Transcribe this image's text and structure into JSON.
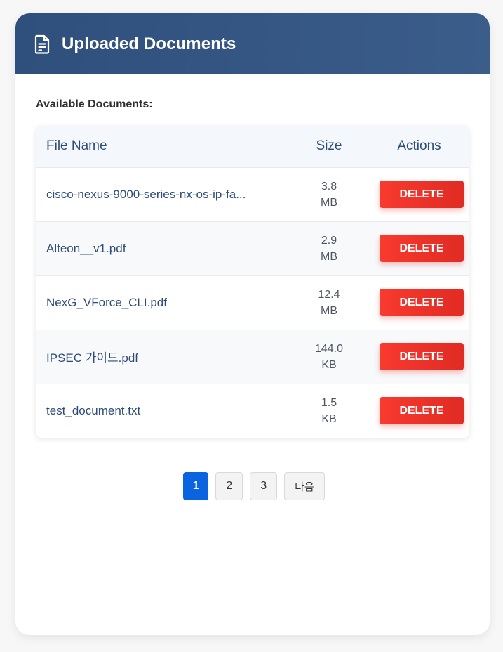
{
  "header": {
    "title": "Uploaded Documents",
    "icon": "document-icon"
  },
  "section": {
    "label": "Available Documents:"
  },
  "table": {
    "columns": [
      "File Name",
      "Size",
      "Actions"
    ],
    "rows": [
      {
        "name": "cisco-nexus-9000-series-nx-os-ip-fa...",
        "size_value": "3.8",
        "size_unit": "MB",
        "action": "DELETE"
      },
      {
        "name": "Alteon__v1.pdf",
        "size_value": "2.9",
        "size_unit": "MB",
        "action": "DELETE"
      },
      {
        "name": "NexG_VForce_CLI.pdf",
        "size_value": "12.4",
        "size_unit": "MB",
        "action": "DELETE"
      },
      {
        "name": "IPSEC 가이드.pdf",
        "size_value": "144.0",
        "size_unit": "KB",
        "action": "DELETE"
      },
      {
        "name": "test_document.txt",
        "size_value": "1.5",
        "size_unit": "KB",
        "action": "DELETE"
      }
    ]
  },
  "pagination": {
    "pages": [
      "1",
      "2",
      "3"
    ],
    "current": "1",
    "next_label": "다음"
  },
  "colors": {
    "header_bg": "#2f4f7c",
    "delete_button": "#f93a2f",
    "active_page": "#0a63e0"
  }
}
